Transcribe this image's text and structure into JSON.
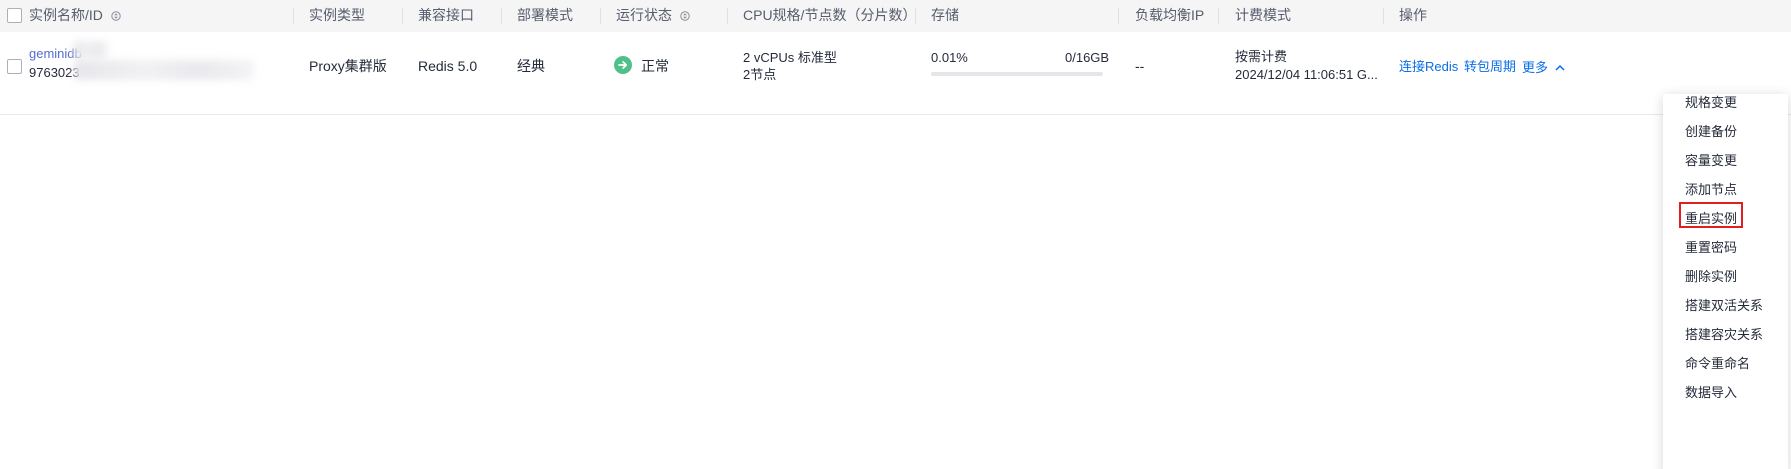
{
  "table": {
    "headers": {
      "name": "实例名称/ID",
      "type": "实例类型",
      "interface": "兼容接口",
      "deploy": "部署模式",
      "status": "运行状态",
      "cpu": "CPU规格/节点数（分片数）",
      "storage": "存储",
      "lb_ip": "负载均衡IP",
      "billing": "计费模式",
      "actions": "操作"
    },
    "row": {
      "name": "geminidb",
      "id": "9763023",
      "type": "Proxy集群版",
      "interface": "Redis 5.0",
      "deploy": "经典",
      "status": "正常",
      "cpu_line1": "2 vCPUs 标准型",
      "cpu_line2": "2节点",
      "storage_used": "0.01%",
      "storage_capacity": "0/16GB",
      "storage_usage_fraction": 0.0001,
      "lb_ip": "--",
      "billing_mode": "按需计费",
      "billing_time": "2024/12/04 11:06:51 G...",
      "action_connect": "连接Redis",
      "action_convert": "转包周期",
      "action_more": "更多"
    }
  },
  "more_menu": {
    "items": [
      "规格变更",
      "创建备份",
      "容量变更",
      "添加节点",
      "重启实例",
      "重置密码",
      "删除实例",
      "搭建双活关系",
      "搭建容灾关系",
      "命令重命名",
      "数据导入"
    ],
    "highlighted": "添加节点"
  },
  "colors": {
    "link": "#0a6ee6",
    "status_ok": "#50c08a",
    "highlight": "#e02020"
  }
}
